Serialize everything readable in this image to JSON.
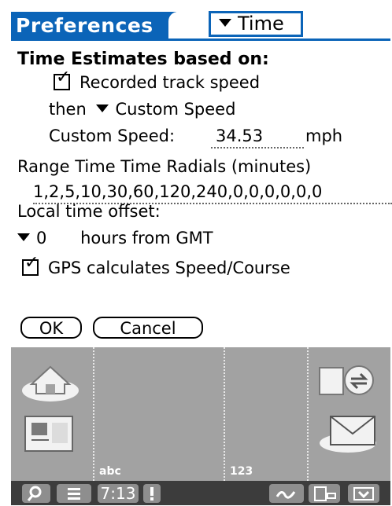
{
  "header": {
    "title": "Preferences",
    "section_selected": "Time"
  },
  "form": {
    "heading": "Time Estimates based on:",
    "recorded_track_speed": {
      "label": "Recorded track speed",
      "checked": true
    },
    "then_label": "then",
    "then_option": "Custom Speed",
    "custom_speed_label": "Custom Speed:",
    "custom_speed_value": "34.53",
    "speed_unit": "mph",
    "radials_label": "Range Time Time Radials (minutes)",
    "radials_value": "1,2,5,10,30,60,120,240,0,0,0,0,0,0",
    "local_offset_label": "Local time offset:",
    "offset_value": "0",
    "offset_suffix": "hours from GMT",
    "gps_calc": {
      "label": "GPS calculates Speed/Course",
      "checked": true
    }
  },
  "buttons": {
    "ok": "OK",
    "cancel": "Cancel"
  },
  "graffiti": {
    "abc_label": "abc",
    "num_label": "123"
  },
  "status_bar": {
    "time": "7:13"
  },
  "colors": {
    "title_blue": "#0b64b8",
    "graffiti_gray": "#a2a2a2",
    "status_dark": "#3c3c3c"
  }
}
